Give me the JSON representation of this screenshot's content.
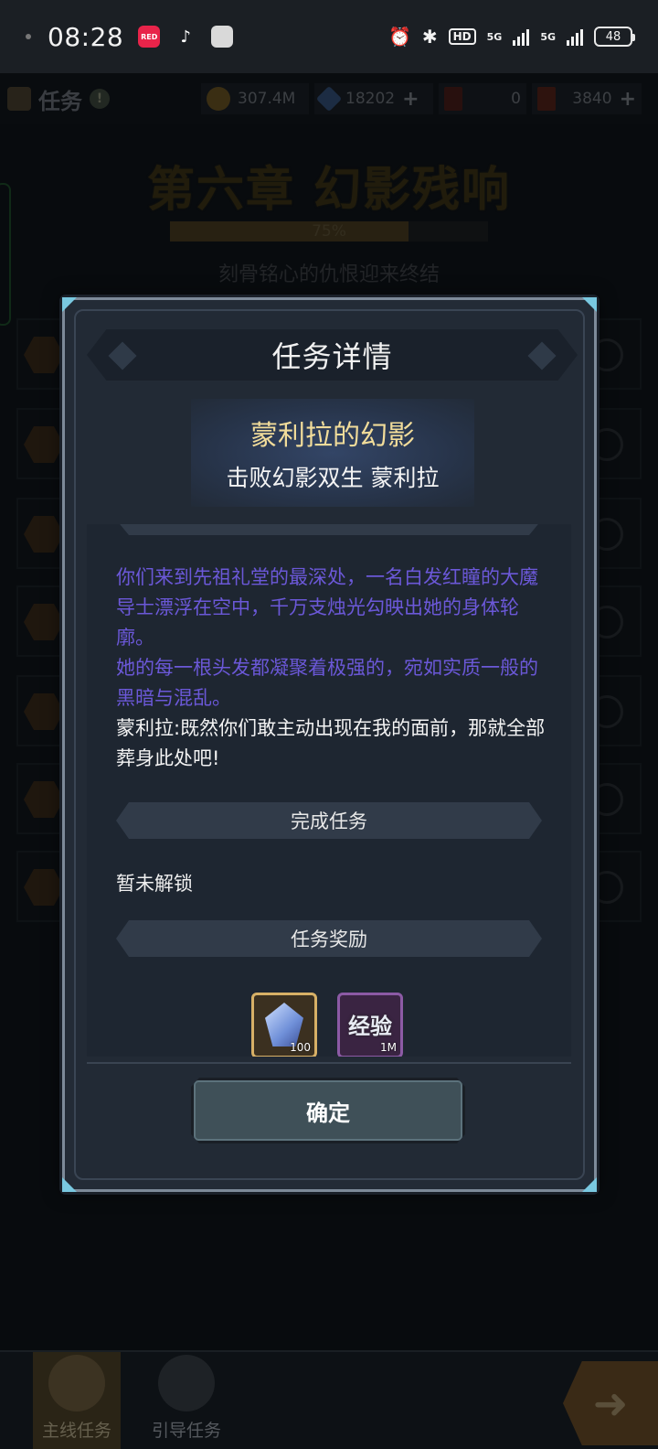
{
  "status_bar": {
    "time": "08:28",
    "app_icons": [
      "xiaohongshu-icon",
      "tiktok-icon",
      "app-icon"
    ],
    "signal_1": "5G",
    "signal_2": "5G",
    "hd_label": "HD",
    "battery": "48"
  },
  "topbar": {
    "title": "任务",
    "resources": [
      {
        "icon": "gold-coin-icon",
        "value": "307.4M",
        "color": "#b8862e",
        "plus": false
      },
      {
        "icon": "crystal-icon",
        "value": "18202",
        "color": "#5d8ad0",
        "plus": true
      },
      {
        "icon": "red-card-icon",
        "value": "0",
        "color": "#8a2a22",
        "plus": false
      },
      {
        "icon": "red-ticket-icon",
        "value": "3840",
        "color": "#9a3a28",
        "plus": true
      }
    ]
  },
  "chapter": {
    "title": "第六章 幻影残响",
    "progress_text": "75%",
    "progress": 0.75,
    "subtitle": "刻骨铭心的仇恨迎来终结"
  },
  "modal": {
    "title": "任务详情",
    "quest_name": "蒙利拉的幻影",
    "quest_sub": "击败幻影双生 蒙利拉",
    "story_paragraphs": [
      {
        "text": "你们来到先祖礼堂的最深处，一名白发红瞳的大魔导士漂浮在空中，千万支烛光勾映出她的身体轮廓。",
        "style": "narration"
      },
      {
        "text": "她的每一根头发都凝聚着极强的，宛如实质一般的黑暗与混乱。",
        "style": "narration"
      },
      {
        "text": "蒙利拉:既然你们敢主动出现在我的面前，那就全部葬身此处吧!",
        "style": "speech"
      }
    ],
    "section_complete": "完成任务",
    "unlock_status": "暂未解锁",
    "section_reward": "任务奖励",
    "rewards": [
      {
        "icon": "blue-crystal-icon",
        "amount": "100"
      },
      {
        "icon": "experience-icon",
        "label": "经验",
        "amount": "1M"
      }
    ],
    "confirm_label": "确定"
  },
  "bottom_nav": {
    "tabs": [
      {
        "label": "主线任务",
        "active": true
      },
      {
        "label": "引导任务",
        "active": false
      }
    ]
  }
}
